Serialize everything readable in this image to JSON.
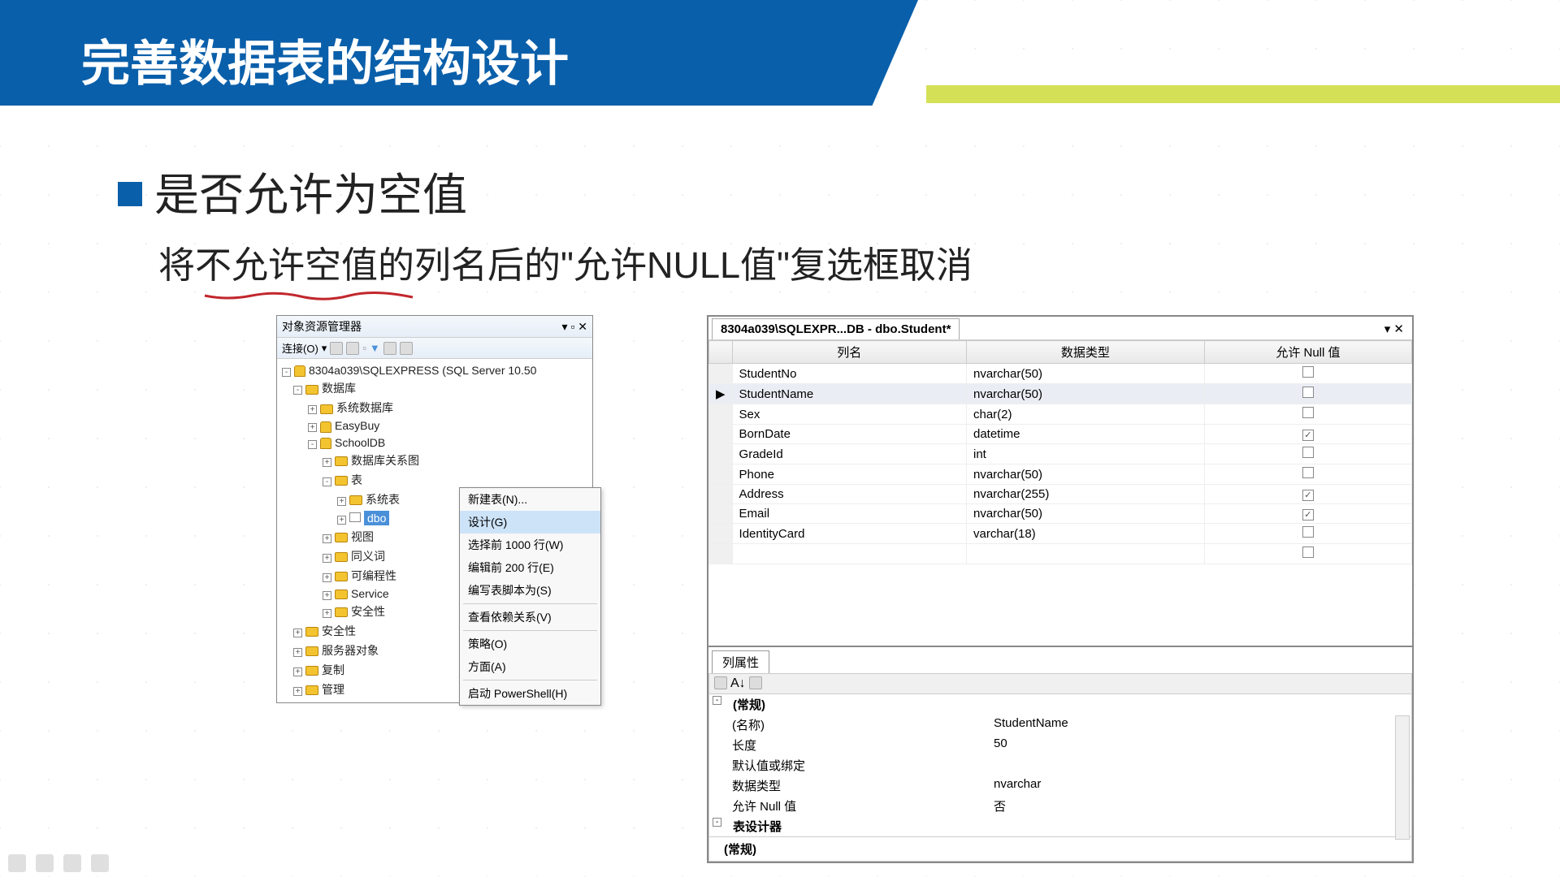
{
  "title": "完善数据表的结构设计",
  "bullet": "是否允许为空值",
  "subtitle": "将不允许空值的列名后的\"允许NULL值\"复选框取消",
  "explorer": {
    "title": "对象资源管理器",
    "connect": "连接(O)",
    "root": "8304a039\\SQLEXPRESS (SQL Server 10.50",
    "nodes": {
      "databases": "数据库",
      "sysdbs": "系统数据库",
      "easybuy": "EasyBuy",
      "schooldb": "SchoolDB",
      "dbdiagram": "数据库关系图",
      "tables": "表",
      "systables": "系统表",
      "dbo": "dbo",
      "views": "视图",
      "synonyms": "同义词",
      "programmability": "可编程性",
      "service": "Service",
      "security_inner": "安全性",
      "security": "安全性",
      "serverobjs": "服务器对象",
      "replication": "复制",
      "management": "管理"
    }
  },
  "context_menu": {
    "new_table": "新建表(N)...",
    "design": "设计(G)",
    "select_top": "选择前 1000 行(W)",
    "edit_top": "编辑前 200 行(E)",
    "script_as": "编写表脚本为(S)",
    "view_deps": "查看依赖关系(V)",
    "policies": "策略(O)",
    "facets": "方面(A)",
    "powershell": "启动 PowerShell(H)"
  },
  "designer": {
    "tab": "8304a039\\SQLEXPR...DB - dbo.Student*",
    "headers": {
      "col": "列名",
      "type": "数据类型",
      "null": "允许 Null 值"
    },
    "rows": [
      {
        "name": "StudentNo",
        "type": "nvarchar(50)",
        "null": false,
        "current": false
      },
      {
        "name": "StudentName",
        "type": "nvarchar(50)",
        "null": false,
        "current": true
      },
      {
        "name": "Sex",
        "type": "char(2)",
        "null": false,
        "current": false
      },
      {
        "name": "BornDate",
        "type": "datetime",
        "null": true,
        "current": false
      },
      {
        "name": "GradeId",
        "type": "int",
        "null": false,
        "current": false
      },
      {
        "name": "Phone",
        "type": "nvarchar(50)",
        "null": false,
        "current": false
      },
      {
        "name": "Address",
        "type": "nvarchar(255)",
        "null": true,
        "current": false
      },
      {
        "name": "Email",
        "type": "nvarchar(50)",
        "null": true,
        "current": false
      },
      {
        "name": "IdentityCard",
        "type": "varchar(18)",
        "null": false,
        "current": false
      }
    ]
  },
  "col_props": {
    "tab": "列属性",
    "group1": "(常规)",
    "name_k": "(名称)",
    "name_v": "StudentName",
    "len_k": "长度",
    "len_v": "50",
    "default_k": "默认值或绑定",
    "default_v": "",
    "type_k": "数据类型",
    "type_v": "nvarchar",
    "null_k": "允许 Null 值",
    "null_v": "否",
    "group2": "表设计器",
    "footer": "(常规)"
  }
}
